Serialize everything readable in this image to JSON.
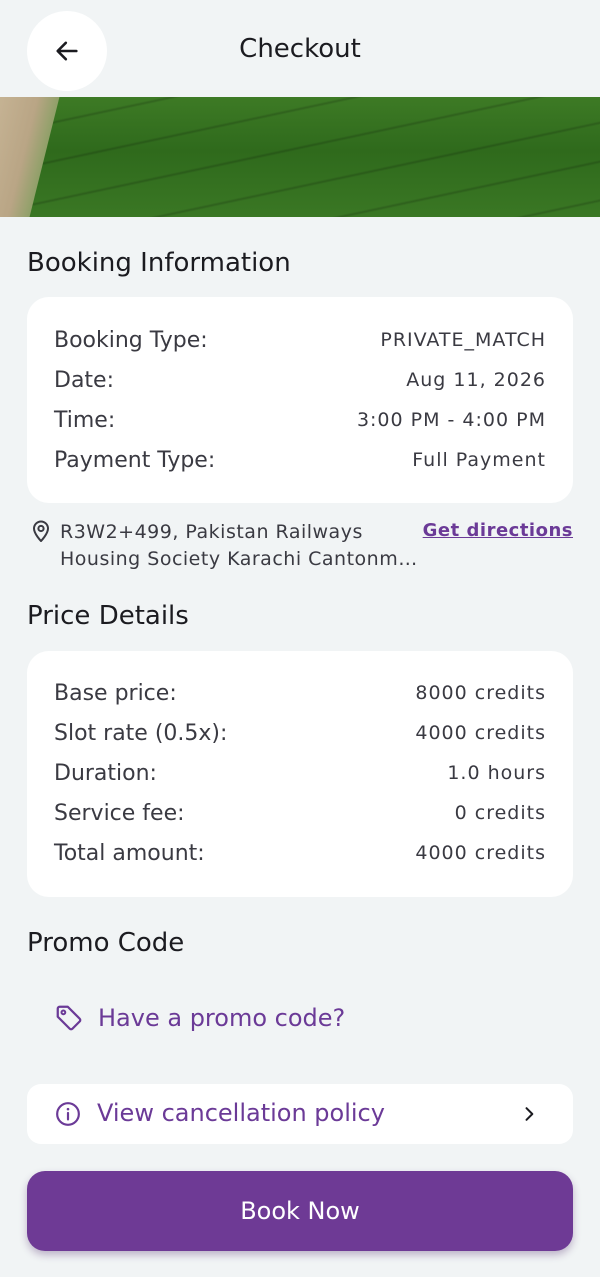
{
  "header": {
    "title": "Checkout"
  },
  "booking": {
    "section_title": "Booking Information",
    "rows": [
      {
        "label": "Booking Type:",
        "value": "PRIVATE_MATCH"
      },
      {
        "label": "Date:",
        "value": "Aug 11, 2026"
      },
      {
        "label": "Time:",
        "value": "3:00 PM - 4:00 PM"
      },
      {
        "label": "Payment Type:",
        "value": "Full Payment"
      }
    ]
  },
  "location": {
    "address_line1": "R3W2+499, Pakistan Railways",
    "address_line2": "Housing Society Karachi Cantonm…",
    "directions_label": "Get directions"
  },
  "price": {
    "section_title": "Price Details",
    "rows": [
      {
        "label": "Base price:",
        "value": "8000 credits"
      },
      {
        "label": "Slot rate (0.5x):",
        "value": "4000 credits"
      },
      {
        "label": "Duration:",
        "value": "1.0 hours"
      },
      {
        "label": "Service fee:",
        "value": "0 credits"
      },
      {
        "label": "Total amount:",
        "value": "4000 credits"
      }
    ]
  },
  "promo": {
    "section_title": "Promo Code",
    "link_label": "Have a promo code?"
  },
  "policy": {
    "label": "View cancellation policy"
  },
  "cta": {
    "label": "Book Now"
  },
  "colors": {
    "accent": "#6e3a95",
    "background": "#f1f4f5",
    "card": "#ffffff"
  },
  "icons": [
    "arrow-left-icon",
    "map-pin-icon",
    "tag-icon",
    "info-icon",
    "chevron-right-icon"
  ]
}
